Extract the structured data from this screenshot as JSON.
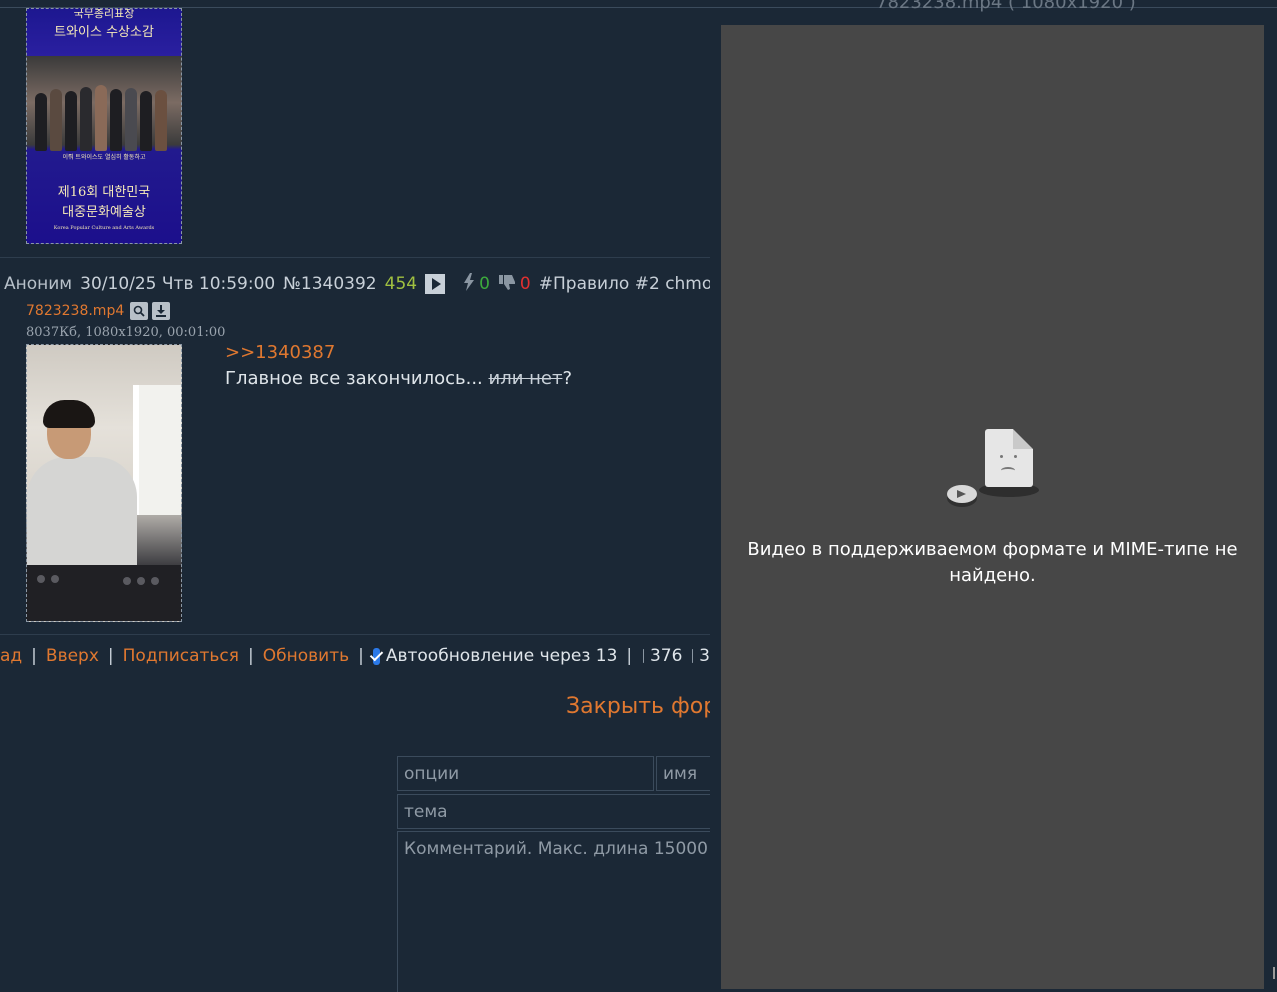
{
  "thumb1": {
    "top_text_1": "국무총리표창",
    "top_text_2": "트와이스 수상소감",
    "mid_text": "이뤄 트와이스도 열심히 활동하고",
    "bottom_text_1": "제16회 대한민국",
    "bottom_text_2": "대중문화예술상",
    "bottom_text_3": "Korea Popular Culture and Arts Awards"
  },
  "post": {
    "author": "Аноним",
    "datetime": "30/10/25 Чтв 10:59:00",
    "number": "№1340392",
    "views": "454",
    "likes": "0",
    "dislikes": "0",
    "tag": "#Правило #2 chmo",
    "file_name": "7823238.mp4",
    "file_meta": "8037Кб, 1080x1920, 00:01:00",
    "reply_link": ">>1340387",
    "text_plain": "Главное все закончилось... ",
    "text_strike": "или нет",
    "text_end": "?"
  },
  "nav": {
    "back": "ад",
    "up": "Вверх",
    "subscribe": "Подписаться",
    "refresh": "Обновить",
    "autoupdate": "Автообновление через 13",
    "posts_count": "376",
    "images_count": "3"
  },
  "form": {
    "close_label": "Закрыть фор",
    "options_placeholder": "опции",
    "name_placeholder": "имя",
    "subject_placeholder": "тема",
    "comment_placeholder": "Комментарий. Макс. длина 15000"
  },
  "viewer": {
    "caption": "7823238.mp4 ( 1080x1920 )",
    "error_line_1": "Видео в поддерживаемом формате и MIME-типе не",
    "error_line_2": "найдено."
  }
}
